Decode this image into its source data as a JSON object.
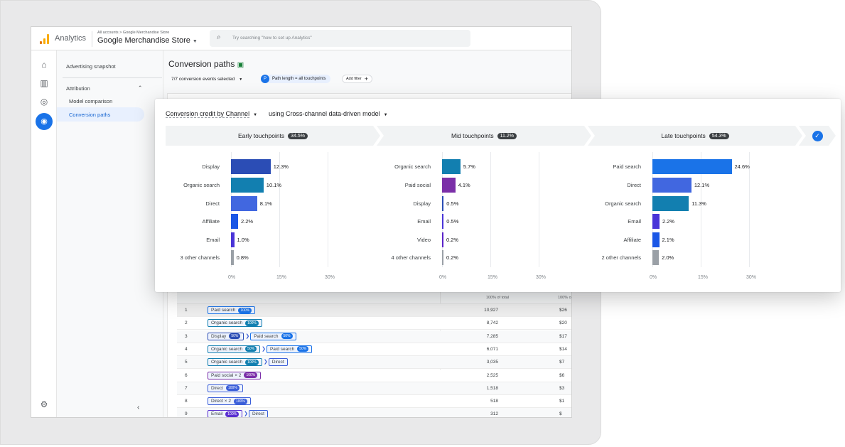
{
  "app": {
    "name": "Analytics",
    "breadcrumb": "All accounts > Google Merchandise Store",
    "property": "Google Merchandise Store",
    "search_placeholder": "Try searching \"how to set up Analytics\""
  },
  "rail": {
    "icons": [
      "home-icon",
      "reports-icon",
      "explore-icon",
      "advertising-icon"
    ],
    "settings": "gear-icon"
  },
  "nav": {
    "items": [
      {
        "label": "Advertising snapshot"
      },
      {
        "label": "Attribution"
      },
      {
        "label": "Model comparison"
      },
      {
        "label": "Conversion paths",
        "active": true
      }
    ]
  },
  "page": {
    "title": "Conversion paths",
    "events": "7/7 conversion events selected",
    "filter_badge": "P",
    "filter": "Path length = all touchpoints",
    "add_filter": "Add filter"
  },
  "card": {
    "dim": "Conversion credit by Channel",
    "model": "using Cross-channel data-driven model",
    "stages": [
      {
        "label": "Early touchpoints",
        "share": "34.5%"
      },
      {
        "label": "Mid touchpoints",
        "share": "11.2%"
      },
      {
        "label": "Late touchpoints",
        "share": "54.3%"
      }
    ]
  },
  "chart_data": [
    {
      "type": "bar",
      "title": "Early touchpoints",
      "categories": [
        "Display",
        "Organic search",
        "Direct",
        "Affiliate",
        "Email",
        "3 other channels"
      ],
      "values": [
        12.3,
        10.1,
        8.1,
        2.2,
        1.0,
        0.8
      ],
      "labels": [
        "12.3%",
        "10.1%",
        "8.1%",
        "2.2%",
        "1.0%",
        "0.8%"
      ],
      "colors": [
        "#2b4db5",
        "#127fb0",
        "#4167e0",
        "#1b57e6",
        "#4a35d8",
        "#9aa0a6"
      ],
      "xlim": [
        0,
        30
      ],
      "ticks": [
        "0%",
        "15%",
        "30%"
      ]
    },
    {
      "type": "bar",
      "title": "Mid touchpoints",
      "categories": [
        "Organic search",
        "Paid social",
        "Display",
        "Email",
        "Video",
        "4 other channels"
      ],
      "values": [
        5.7,
        4.1,
        0.5,
        0.5,
        0.2,
        0.2
      ],
      "labels": [
        "5.7%",
        "4.1%",
        "0.5%",
        "0.5%",
        "0.2%",
        "0.2%"
      ],
      "colors": [
        "#127fb0",
        "#7b2fa8",
        "#2b4db5",
        "#4a35d8",
        "#5a22c8",
        "#9aa0a6"
      ],
      "xlim": [
        0,
        30
      ],
      "ticks": [
        "0%",
        "15%",
        "30%"
      ]
    },
    {
      "type": "bar",
      "title": "Late touchpoints",
      "categories": [
        "Paid search",
        "Direct",
        "Organic search",
        "Email",
        "Affiliate",
        "2 other channels"
      ],
      "values": [
        24.6,
        12.1,
        11.3,
        2.2,
        2.1,
        2.0
      ],
      "labels": [
        "24.6%",
        "12.1%",
        "11.3%",
        "2.2%",
        "2.1%",
        "2.0%"
      ],
      "colors": [
        "#1a73e8",
        "#4167e0",
        "#127fb0",
        "#4a35d8",
        "#1b57e6",
        "#9aa0a6"
      ],
      "xlim": [
        0,
        30
      ],
      "ticks": [
        "0%",
        "15%",
        "30%"
      ]
    }
  ],
  "table": {
    "headers": [
      "100% of total",
      "100% o"
    ],
    "rows": [
      {
        "n": "1",
        "path": [
          {
            "c": "Paid search",
            "p": "100%",
            "k": "ps"
          }
        ],
        "conv": "10,927",
        "rev": "$26"
      },
      {
        "n": "2",
        "path": [
          {
            "c": "Organic search",
            "p": "100%",
            "k": "os"
          }
        ],
        "conv": "8,742",
        "rev": "$20"
      },
      {
        "n": "3",
        "path": [
          {
            "c": "Display",
            "p": "50%",
            "k": "d"
          },
          {
            "c": "Paid search",
            "p": "50%",
            "k": "ps"
          }
        ],
        "conv": "7,285",
        "rev": "$17"
      },
      {
        "n": "4",
        "path": [
          {
            "c": "Organic search",
            "p": "50%",
            "k": "os"
          },
          {
            "c": "Paid search",
            "p": "50%",
            "k": "ps"
          }
        ],
        "conv": "6,071",
        "rev": "$14"
      },
      {
        "n": "5",
        "path": [
          {
            "c": "Organic search",
            "p": "100%",
            "k": "os"
          },
          {
            "c": "Direct",
            "p": "",
            "k": "dr"
          }
        ],
        "conv": "3,035",
        "rev": "$7"
      },
      {
        "n": "6",
        "path": [
          {
            "c": "Paid social × 2",
            "p": "100%",
            "k": "so"
          }
        ],
        "conv": "2,525",
        "rev": "$6"
      },
      {
        "n": "7",
        "path": [
          {
            "c": "Direct",
            "p": "100%",
            "k": "dr"
          }
        ],
        "conv": "1,518",
        "rev": "$3"
      },
      {
        "n": "8",
        "path": [
          {
            "c": "Direct × 2",
            "p": "100%",
            "k": "dr"
          }
        ],
        "conv": "518",
        "rev": "$1"
      },
      {
        "n": "9",
        "path": [
          {
            "c": "Email",
            "p": "100%",
            "k": "em"
          },
          {
            "c": "Direct",
            "p": "",
            "k": "dr"
          }
        ],
        "conv": "312",
        "rev": "$"
      }
    ]
  },
  "colors": {
    "accent": "#1a73e8",
    "ps": "#1a73e8",
    "os": "#127fb0",
    "d": "#2b4db5",
    "dr": "#3b5fd9",
    "so": "#7b2fa8",
    "em": "#5a2fd0"
  }
}
